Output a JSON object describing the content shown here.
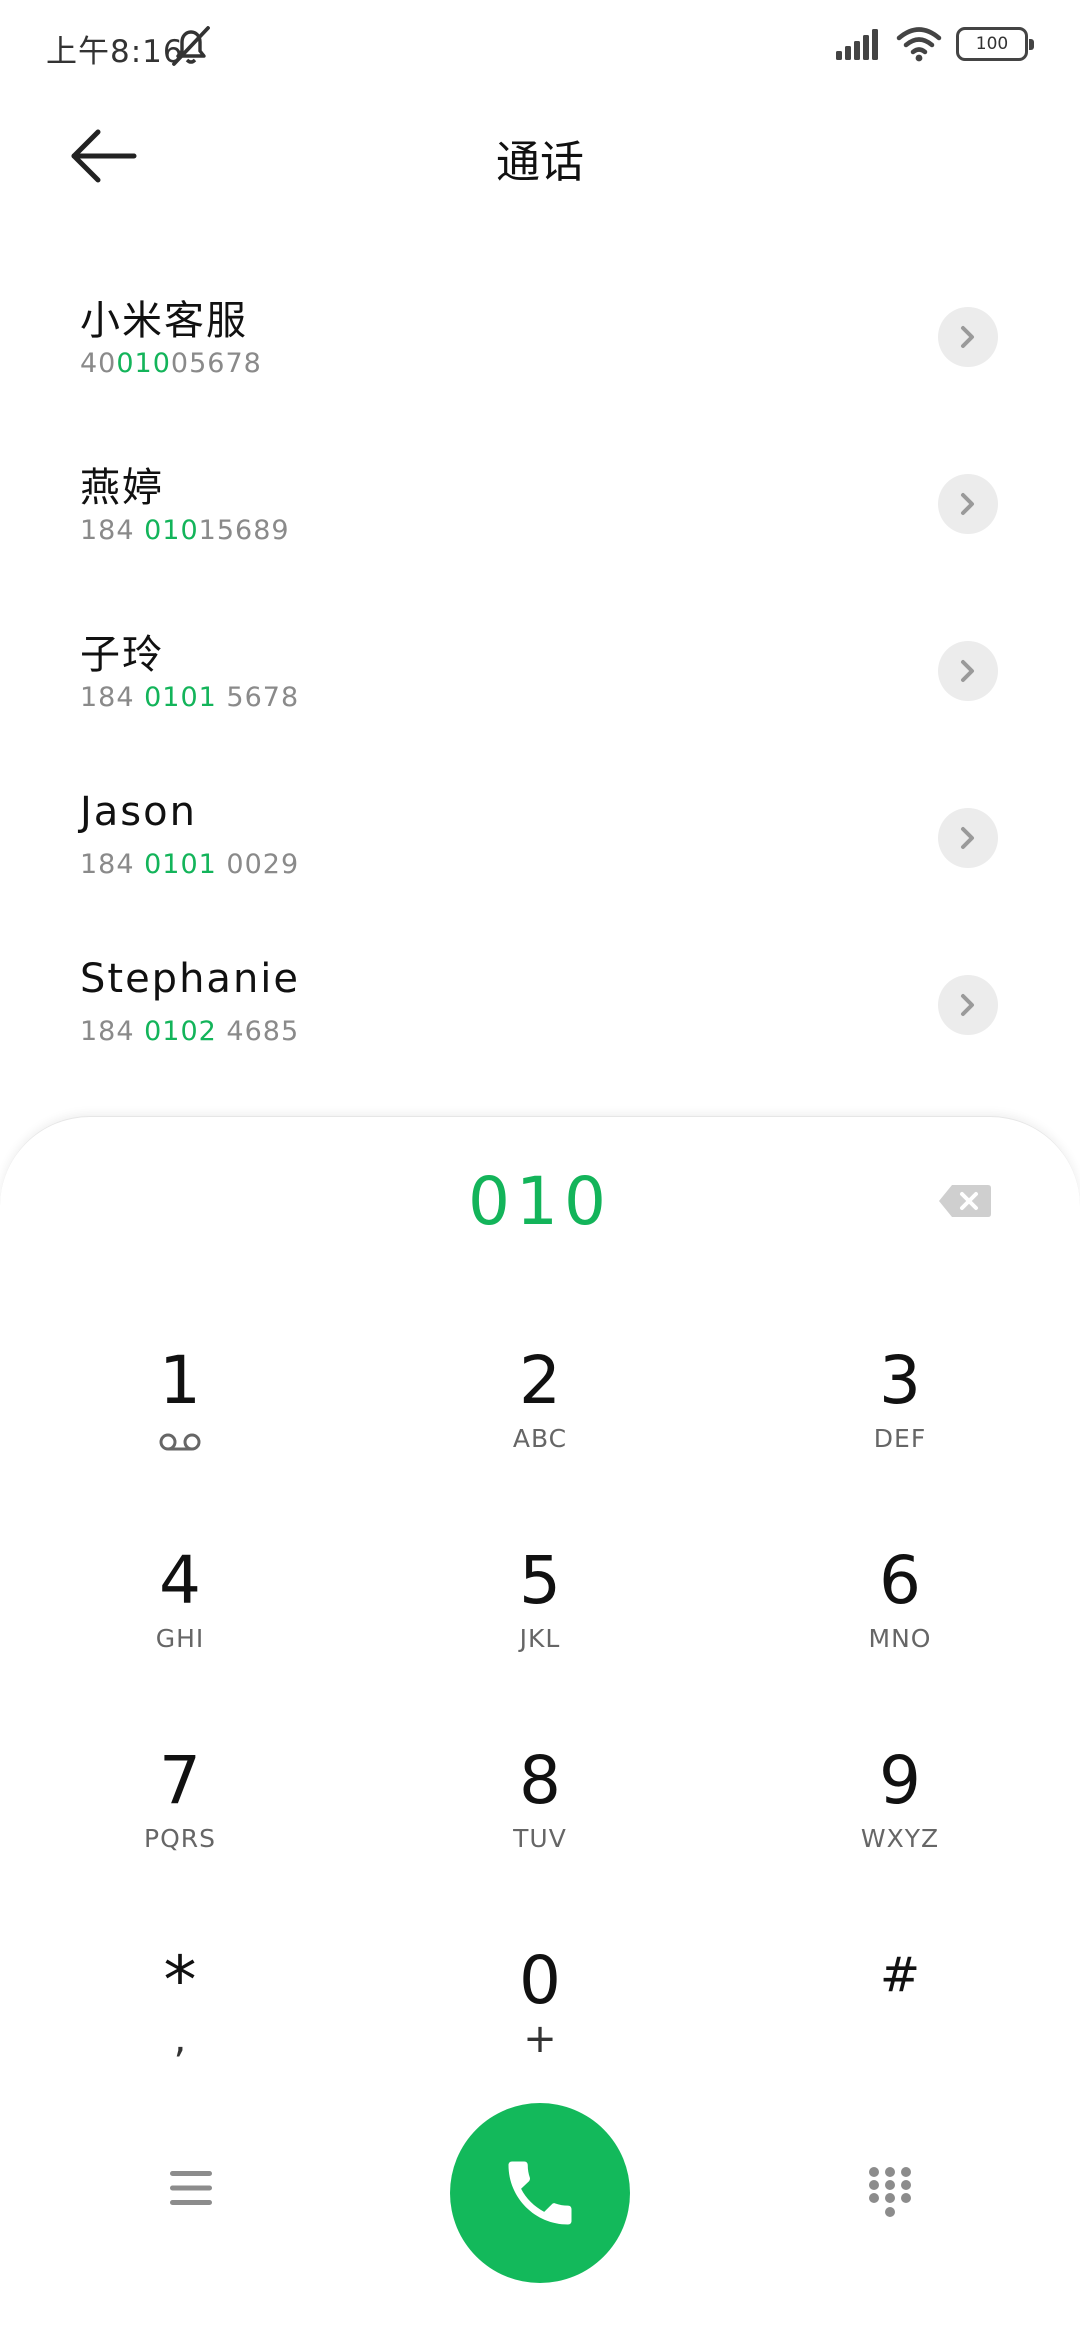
{
  "status_bar": {
    "time": "上午8:16",
    "battery": "100"
  },
  "header": {
    "title": "通话"
  },
  "contacts": [
    {
      "name": "小米客服",
      "number_before": "40",
      "number_match": "010",
      "number_after": "05678"
    },
    {
      "name": "燕婷",
      "number_before": "184 ",
      "number_match": "010",
      "number_after": "15689"
    },
    {
      "name": "子玲",
      "number_before": "184 ",
      "number_match": "0101",
      "number_after": " 5678"
    },
    {
      "name": "Jason",
      "number_before": "184 ",
      "number_match": "0101",
      "number_after": " 0029"
    },
    {
      "name": "Stephanie",
      "number_before": "184 ",
      "number_match": "0102",
      "number_after": " 4685"
    }
  ],
  "dialer": {
    "input_value": "010",
    "keys": [
      {
        "digit": "1",
        "letters": ""
      },
      {
        "digit": "2",
        "letters": "ABC"
      },
      {
        "digit": "3",
        "letters": "DEF"
      },
      {
        "digit": "4",
        "letters": "GHI"
      },
      {
        "digit": "5",
        "letters": "JKL"
      },
      {
        "digit": "6",
        "letters": "MNO"
      },
      {
        "digit": "7",
        "letters": "PQRS"
      },
      {
        "digit": "8",
        "letters": "TUV"
      },
      {
        "digit": "9",
        "letters": "WXYZ"
      },
      {
        "digit": "*",
        "letters": ","
      },
      {
        "digit": "0",
        "letters": "+"
      },
      {
        "digit": "#",
        "letters": ""
      }
    ]
  },
  "colors": {
    "accent": "#13b45a",
    "call_button": "#13b95b"
  },
  "icons": {
    "back": "arrow-left-icon",
    "detail": "chevron-right-icon",
    "backspace": "backspace-icon",
    "menu": "menu-icon",
    "call": "phone-icon",
    "keypad": "dialpad-icon",
    "voicemail": "voicemail-icon"
  }
}
